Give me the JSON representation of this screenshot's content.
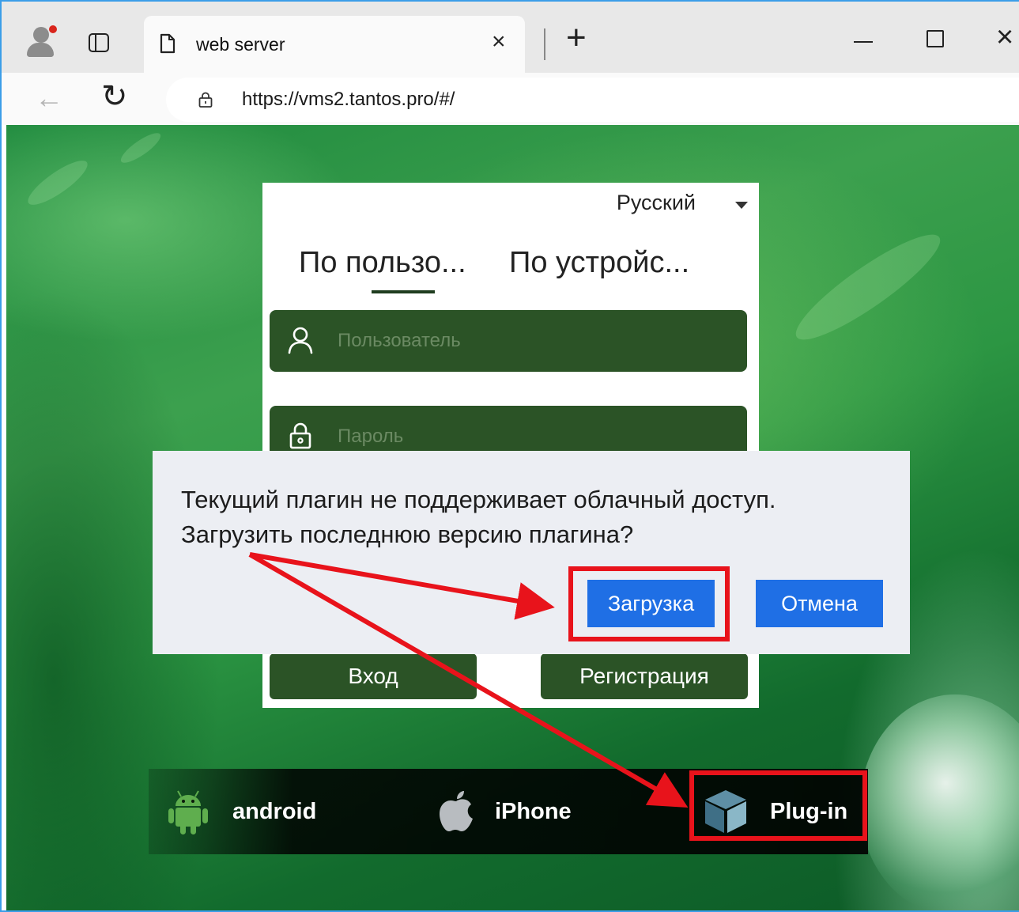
{
  "browser": {
    "tab_title": "web server",
    "tab_close": "×",
    "new_tab": "+",
    "url": "https://vms2.tantos.pro/#/",
    "window_controls": {
      "minimize": "minimize",
      "maximize": "maximize",
      "close": "×"
    }
  },
  "login": {
    "language": "Русский",
    "tabs": [
      {
        "label": "По пользо...",
        "active": true
      },
      {
        "label": "По устройс...",
        "active": false
      }
    ],
    "username_placeholder": "Пользователь",
    "password_placeholder": "Пароль",
    "login_button": "Вход",
    "register_button": "Регистрация"
  },
  "dialog": {
    "message_line1": "Текущий плагин не поддерживает облачный доступ.",
    "message_line2": "Загрузить последнюю версию плагина?",
    "download_button": "Загрузка",
    "cancel_button": "Отмена"
  },
  "apps": [
    {
      "label": "android",
      "icon": "android-icon"
    },
    {
      "label": "iPhone",
      "icon": "apple-icon"
    },
    {
      "label": "Plug-in",
      "icon": "cube-icon"
    }
  ],
  "colors": {
    "field_green": "#2b5326",
    "dialog_button_blue": "#1f6fe5",
    "highlight_red": "#e8131b",
    "browser_accent": "#3b9ee8"
  }
}
